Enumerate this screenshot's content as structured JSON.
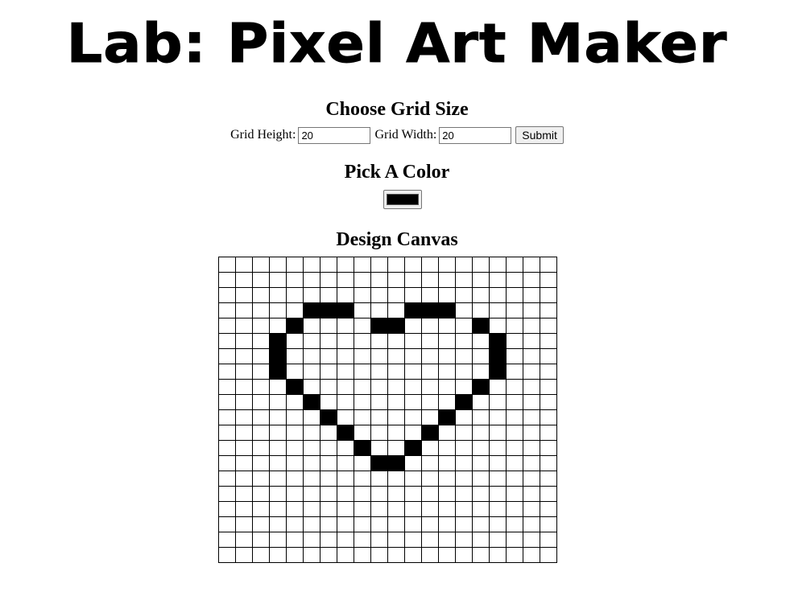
{
  "header": {
    "title": "Lab: Pixel Art Maker"
  },
  "grid_size": {
    "heading": "Choose Grid Size",
    "height_label": "Grid Height:",
    "height_value": "20",
    "width_label": "Grid Width:",
    "width_value": "20",
    "submit_label": "Submit"
  },
  "color_picker": {
    "heading": "Pick A Color",
    "value": "#000000"
  },
  "canvas": {
    "heading": "Design Canvas",
    "rows": 20,
    "cols": 20,
    "fill_color": "#000000",
    "filled": [
      [
        3,
        5
      ],
      [
        3,
        6
      ],
      [
        3,
        7
      ],
      [
        3,
        11
      ],
      [
        3,
        12
      ],
      [
        3,
        13
      ],
      [
        4,
        4
      ],
      [
        4,
        9
      ],
      [
        4,
        10
      ],
      [
        4,
        15
      ],
      [
        5,
        3
      ],
      [
        5,
        16
      ],
      [
        6,
        3
      ],
      [
        6,
        16
      ],
      [
        7,
        3
      ],
      [
        7,
        16
      ],
      [
        8,
        4
      ],
      [
        8,
        15
      ],
      [
        9,
        5
      ],
      [
        9,
        14
      ],
      [
        10,
        6
      ],
      [
        10,
        13
      ],
      [
        11,
        7
      ],
      [
        11,
        12
      ],
      [
        12,
        8
      ],
      [
        12,
        11
      ],
      [
        13,
        9
      ],
      [
        13,
        10
      ]
    ]
  }
}
